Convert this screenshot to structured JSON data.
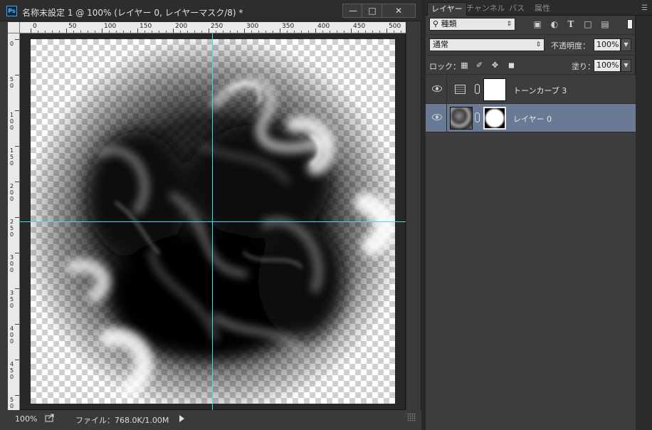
{
  "document": {
    "title": "名称未設定 1 @ 100% (レイヤー 0, レイヤーマスク/8) *",
    "app_badge": "Ps",
    "window_buttons": [
      "minimize",
      "maximize",
      "close"
    ]
  },
  "rulers": {
    "top_labels": [
      "0",
      "50",
      "100",
      "150",
      "200",
      "250",
      "300",
      "350",
      "400",
      "450",
      "500"
    ],
    "left_labels": [
      "0",
      "50",
      "100",
      "150",
      "200",
      "250",
      "300",
      "350",
      "400",
      "450",
      "500"
    ]
  },
  "status": {
    "zoom": "100%",
    "file_info": "ファイル：768.0K/1.00M"
  },
  "panel": {
    "tabs": [
      "レイヤー",
      "チャンネル",
      "パス",
      "属性"
    ],
    "active_tab": "レイヤー",
    "kind_filter": "種類",
    "filter_icons": [
      "image-icon",
      "adjustment-icon",
      "type-icon",
      "shape-icon",
      "smart-object-icon"
    ],
    "blend_mode": "通常",
    "opacity_label": "不透明度：",
    "opacity_value": "100%",
    "lock_label": "ロック：",
    "lock_icons": [
      "lock-transparency-icon",
      "lock-brush-icon",
      "lock-move-icon",
      "lock-all-icon"
    ],
    "fill_label": "塗り：",
    "fill_value": "100%"
  },
  "layers": [
    {
      "name": "トーンカーブ 3",
      "type": "adjustment",
      "visible": true,
      "selected": false
    },
    {
      "name": "レイヤー 0",
      "type": "image",
      "visible": true,
      "selected": true
    }
  ],
  "colors": {
    "guide": "#33e6e6",
    "selected_layer": "#6a7a94",
    "panel_bg": "#3d3d3d"
  }
}
